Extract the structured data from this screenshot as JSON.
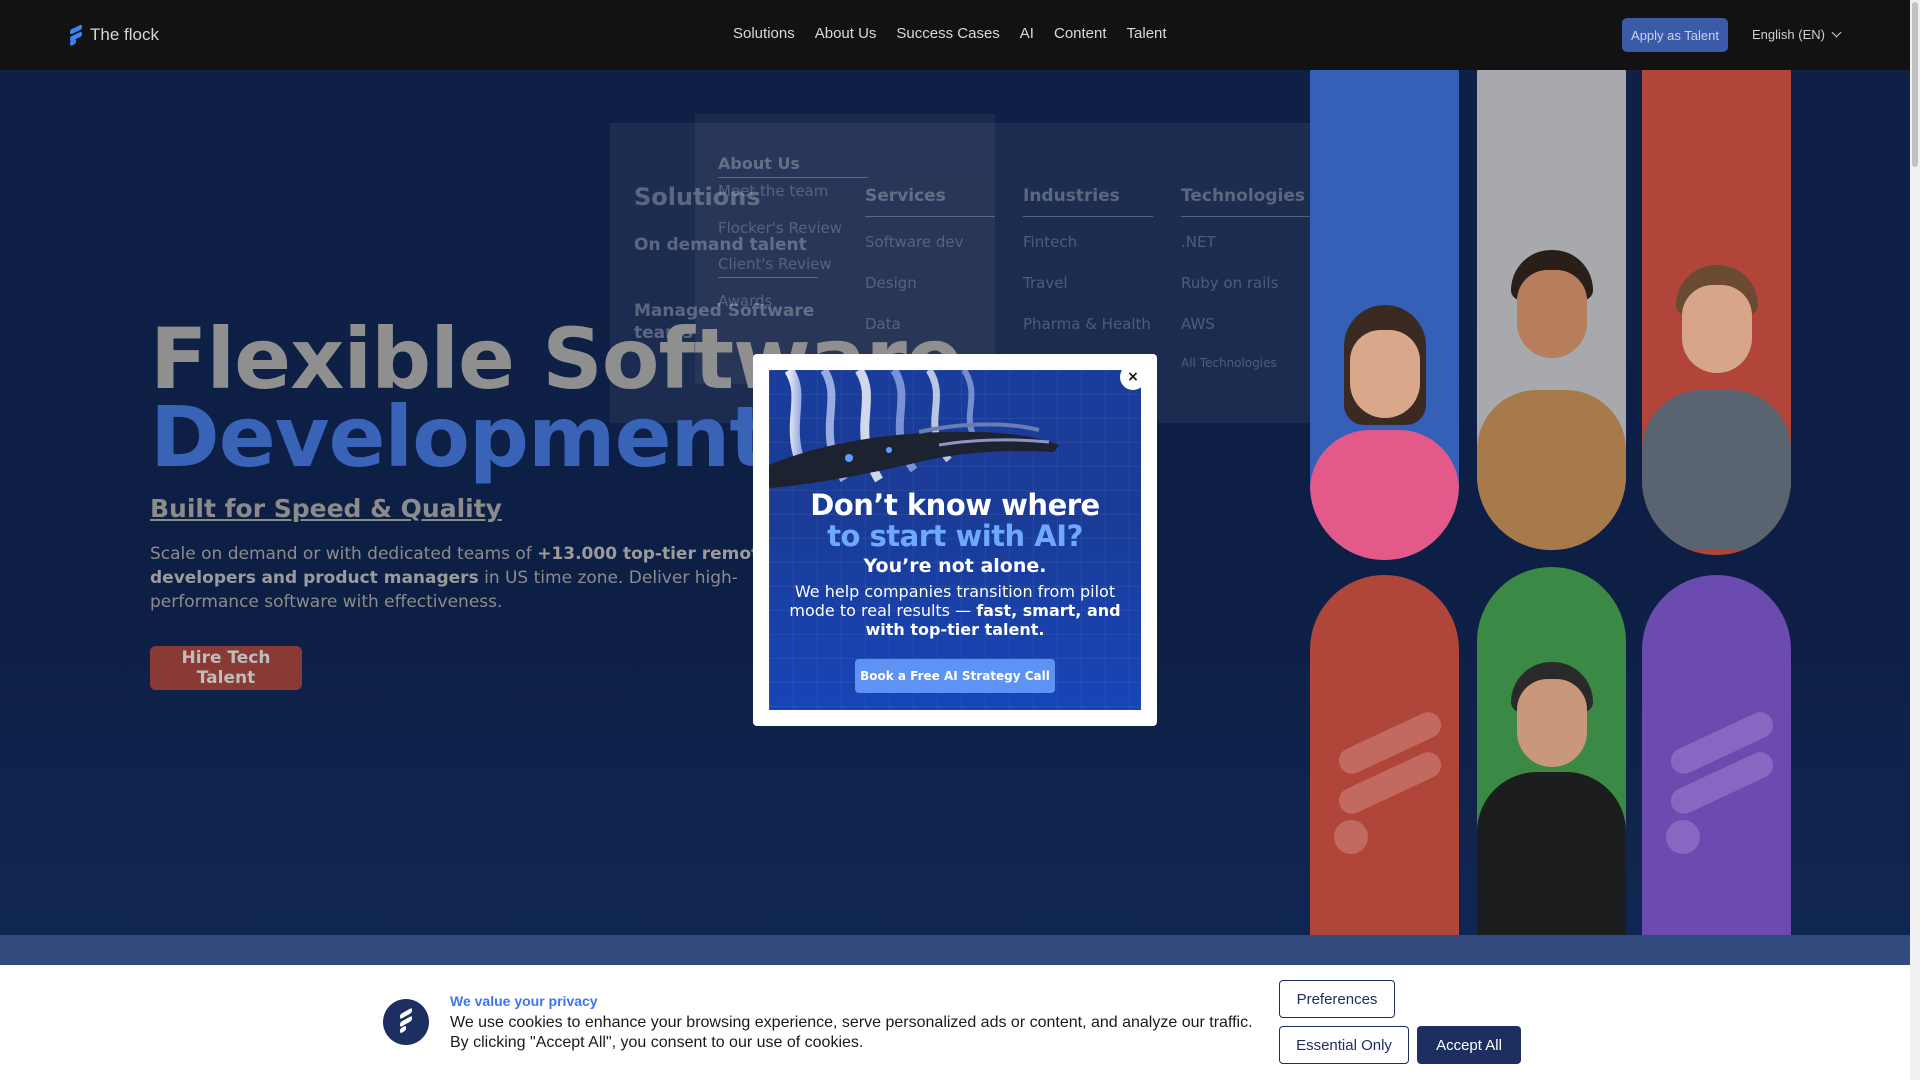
{
  "header": {
    "logo_text": "The flock",
    "nav": [
      "Solutions",
      "About Us",
      "Success Cases",
      "AI",
      "Content",
      "Talent"
    ],
    "apply_label": "Apply as Talent",
    "language": "English (EN)"
  },
  "hero": {
    "title_line1": "Flexible Software",
    "title_line2": "Development",
    "subtitle": "Built for Speed & Quality",
    "body_pre": "Scale on demand or with dedicated teams of ",
    "body_bold1": "+13.000 top-tier remote developers",
    "body_mid": " ",
    "body_bold2": "and product managers",
    "body_post": " in US time zone. Deliver high-performance software with effectiveness.",
    "cta_label": "Hire Tech Talent"
  },
  "mega_menu": {
    "solutions_title": "Solutions",
    "on_demand": "On demand talent",
    "managed": "Managed Software",
    "managed2": "teams",
    "about_title": "About Us",
    "about_items": [
      "Meet the team",
      "Flocker's Review",
      "Client's Review",
      "Awards"
    ],
    "services_title": "Services",
    "services_items": [
      "Software dev",
      "Design",
      "Data"
    ],
    "industries_title": "Industries",
    "industries_items": [
      "Fintech",
      "Travel",
      "Pharma & Health"
    ],
    "technologies_title": "Technologies",
    "technologies_items": [
      ".NET",
      "Ruby on rails",
      "AWS",
      "All Technologies"
    ]
  },
  "modal": {
    "headline1": "Don’t know where",
    "headline2": "to start with AI?",
    "headline3": "You’re not alone.",
    "body_pre": "We help companies transition from pilot mode to real results — ",
    "body_bold": "fast, smart, and with top-tier talent.",
    "cta_label": "Book a Free AI Strategy Call",
    "close_label": "×"
  },
  "cookie": {
    "title": "We value your privacy",
    "text": "We use cookies to enhance your browsing experience, serve personalized ads or content, and analyze our traffic. By clicking \"Accept All\", you consent to our use of cookies.",
    "preferences_label": "Preferences",
    "essential_label": "Essential Only",
    "accept_label": "Accept All"
  },
  "colors": {
    "accent_blue": "#3863b7",
    "cta_red": "#8a3a34",
    "cookie_navy": "#1d2f60"
  }
}
